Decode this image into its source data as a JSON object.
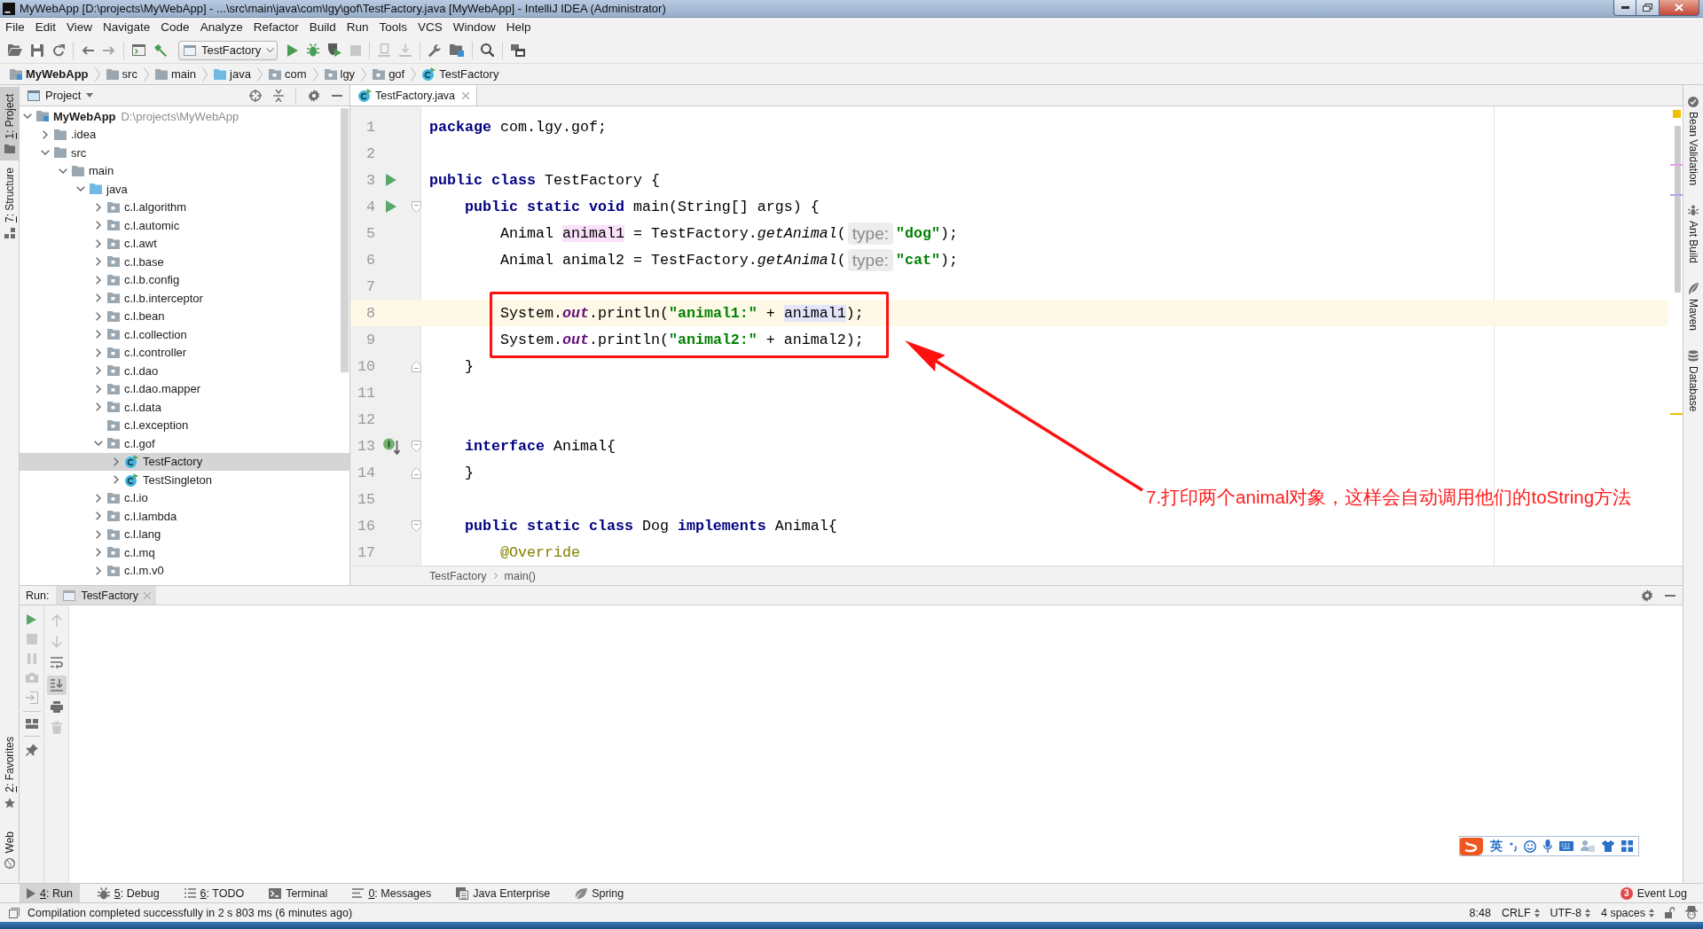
{
  "window": {
    "title": "MyWebApp [D:\\projects\\MyWebApp] - ...\\src\\main\\java\\com\\lgy\\gof\\TestFactory.java [MyWebApp] - IntelliJ IDEA (Administrator)"
  },
  "menu": [
    "File",
    "Edit",
    "View",
    "Navigate",
    "Code",
    "Analyze",
    "Refactor",
    "Build",
    "Run",
    "Tools",
    "VCS",
    "Window",
    "Help"
  ],
  "toolbar": {
    "run_config": "TestFactory"
  },
  "navigation_bar": [
    {
      "label": "MyWebApp",
      "kind": "module"
    },
    {
      "label": "src",
      "kind": "folder"
    },
    {
      "label": "main",
      "kind": "folder"
    },
    {
      "label": "java",
      "kind": "source-folder"
    },
    {
      "label": "com",
      "kind": "package"
    },
    {
      "label": "lgy",
      "kind": "package"
    },
    {
      "label": "gof",
      "kind": "package"
    },
    {
      "label": "TestFactory",
      "kind": "class"
    }
  ],
  "left_stripe": {
    "top": [
      {
        "key": "1",
        "label": ": Project",
        "selected": true
      },
      {
        "key": "7",
        "label": ": Structure",
        "selected": false
      }
    ],
    "bottom": [
      {
        "key": "2",
        "label": ": Favorites",
        "selected": false
      },
      {
        "label": "Web",
        "selected": false
      }
    ]
  },
  "project_panel": {
    "title": "Project",
    "tree": [
      {
        "label": "MyWebApp",
        "note": "D:\\projects\\MyWebApp",
        "kind": "module",
        "expanded": true,
        "selected": false,
        "children": [
          {
            "label": ".idea",
            "kind": "folder",
            "expanded": false,
            "selected": false
          },
          {
            "label": "src",
            "kind": "folder",
            "expanded": true,
            "selected": false,
            "children": [
              {
                "label": "main",
                "kind": "folder",
                "expanded": true,
                "selected": false,
                "children": [
                  {
                    "label": "java",
                    "kind": "source-folder",
                    "expanded": true,
                    "selected": false,
                    "children": [
                      {
                        "label": "c.l.algorithm",
                        "kind": "package",
                        "expanded": false,
                        "selected": false
                      },
                      {
                        "label": "c.l.automic",
                        "kind": "package",
                        "expanded": false,
                        "selected": false
                      },
                      {
                        "label": "c.l.awt",
                        "kind": "package",
                        "expanded": false,
                        "selected": false
                      },
                      {
                        "label": "c.l.base",
                        "kind": "package",
                        "expanded": false,
                        "selected": false
                      },
                      {
                        "label": "c.l.b.config",
                        "kind": "package",
                        "expanded": false,
                        "selected": false
                      },
                      {
                        "label": "c.l.b.interceptor",
                        "kind": "package",
                        "expanded": false,
                        "selected": false
                      },
                      {
                        "label": "c.l.bean",
                        "kind": "package",
                        "expanded": false,
                        "selected": false
                      },
                      {
                        "label": "c.l.collection",
                        "kind": "package",
                        "expanded": false,
                        "selected": false
                      },
                      {
                        "label": "c.l.controller",
                        "kind": "package",
                        "expanded": false,
                        "selected": false
                      },
                      {
                        "label": "c.l.dao",
                        "kind": "package",
                        "expanded": false,
                        "selected": false
                      },
                      {
                        "label": "c.l.dao.mapper",
                        "kind": "package",
                        "expanded": false,
                        "selected": false
                      },
                      {
                        "label": "c.l.data",
                        "kind": "package",
                        "expanded": false,
                        "selected": false
                      },
                      {
                        "label": "c.l.exception",
                        "kind": "package",
                        "selected": false
                      },
                      {
                        "label": "c.l.gof",
                        "kind": "package",
                        "expanded": true,
                        "selected": false,
                        "children": [
                          {
                            "label": "TestFactory",
                            "kind": "class",
                            "expanded": false,
                            "selected": true
                          },
                          {
                            "label": "TestSingleton",
                            "kind": "class",
                            "expanded": false,
                            "selected": false
                          }
                        ]
                      },
                      {
                        "label": "c.l.io",
                        "kind": "package",
                        "expanded": false,
                        "selected": false
                      },
                      {
                        "label": "c.l.lambda",
                        "kind": "package",
                        "expanded": false,
                        "selected": false
                      },
                      {
                        "label": "c.l.lang",
                        "kind": "package",
                        "expanded": false,
                        "selected": false
                      },
                      {
                        "label": "c.l.mq",
                        "kind": "package",
                        "expanded": false,
                        "selected": false
                      },
                      {
                        "label": "c.l.m.v0",
                        "kind": "package",
                        "expanded": false,
                        "selected": false
                      }
                    ]
                  }
                ]
              }
            ]
          }
        ]
      }
    ]
  },
  "editor": {
    "tabs": [
      {
        "label": "TestFactory.java",
        "selected": true
      }
    ],
    "lines": [
      {
        "number": "1",
        "current": false,
        "run_marker": false,
        "implements_marker": false,
        "fold_start": false,
        "fold_end": false,
        "tokens": [
          {
            "kind": "keyword",
            "text": "package"
          },
          {
            "kind": "plain",
            "text": " com.lgy.gof;"
          }
        ]
      },
      {
        "number": "2",
        "current": false,
        "run_marker": false,
        "implements_marker": false,
        "fold_start": false,
        "fold_end": false
      },
      {
        "number": "3",
        "current": false,
        "run_marker": true,
        "implements_marker": false,
        "fold_start": false,
        "fold_end": false,
        "tokens": [
          {
            "kind": "keyword",
            "text": "public class"
          },
          {
            "kind": "plain",
            "text": " TestFactory {"
          }
        ]
      },
      {
        "number": "4",
        "current": false,
        "run_marker": true,
        "implements_marker": false,
        "fold_start": true,
        "fold_end": false,
        "tokens": [
          {
            "kind": "keyword",
            "text": "    public static void"
          },
          {
            "kind": "plain",
            "text": " main(String[] args) {"
          }
        ]
      },
      {
        "number": "5",
        "current": false,
        "run_marker": false,
        "implements_marker": false,
        "fold_start": false,
        "fold_end": false,
        "tokens": [
          {
            "kind": "plain",
            "text": "        Animal "
          },
          {
            "kind": "declaration",
            "text": "animal1"
          },
          {
            "kind": "plain",
            "text": " = TestFactory."
          },
          {
            "kind": "method",
            "text": "getAnimal"
          },
          {
            "kind": "plain",
            "text": "("
          },
          {
            "kind": "hint",
            "text": "type:"
          },
          {
            "kind": "string",
            "text": "\"dog\""
          },
          {
            "kind": "plain",
            "text": ");"
          }
        ]
      },
      {
        "number": "6",
        "current": false,
        "run_marker": false,
        "implements_marker": false,
        "fold_start": false,
        "fold_end": false,
        "tokens": [
          {
            "kind": "plain",
            "text": "        Animal animal2 = TestFactory."
          },
          {
            "kind": "method",
            "text": "getAnimal"
          },
          {
            "kind": "plain",
            "text": "("
          },
          {
            "kind": "hint",
            "text": "type:"
          },
          {
            "kind": "string",
            "text": "\"cat\""
          },
          {
            "kind": "plain",
            "text": ");"
          }
        ]
      },
      {
        "number": "7",
        "current": false,
        "run_marker": false,
        "implements_marker": false,
        "fold_start": false,
        "fold_end": false
      },
      {
        "number": "8",
        "current": true,
        "run_marker": false,
        "implements_marker": false,
        "fold_start": false,
        "fold_end": false,
        "tokens": [
          {
            "kind": "plain",
            "text": "        System."
          },
          {
            "kind": "field",
            "text": "out"
          },
          {
            "kind": "plain",
            "text": ".println("
          },
          {
            "kind": "string",
            "text": "\"animal1:\""
          },
          {
            "kind": "plain",
            "text": " + "
          },
          {
            "kind": "usage",
            "text": "animal1"
          },
          {
            "kind": "plain",
            "text": ");"
          }
        ]
      },
      {
        "number": "9",
        "current": false,
        "run_marker": false,
        "implements_marker": false,
        "fold_start": false,
        "fold_end": false,
        "tokens": [
          {
            "kind": "plain",
            "text": "        System."
          },
          {
            "kind": "field",
            "text": "out"
          },
          {
            "kind": "plain",
            "text": ".println("
          },
          {
            "kind": "string",
            "text": "\"animal2:\""
          },
          {
            "kind": "plain",
            "text": " + animal2);"
          }
        ]
      },
      {
        "number": "10",
        "current": false,
        "run_marker": false,
        "implements_marker": false,
        "fold_start": false,
        "fold_end": true,
        "tokens": [
          {
            "kind": "plain",
            "text": "    }"
          }
        ]
      },
      {
        "number": "11",
        "current": false,
        "run_marker": false,
        "implements_marker": false,
        "fold_start": false,
        "fold_end": false
      },
      {
        "number": "12",
        "current": false,
        "run_marker": false,
        "implements_marker": false,
        "fold_start": false,
        "fold_end": false
      },
      {
        "number": "13",
        "current": false,
        "run_marker": false,
        "implements_marker": true,
        "fold_start": true,
        "fold_end": false,
        "tokens": [
          {
            "kind": "keyword",
            "text": "    interface"
          },
          {
            "kind": "plain",
            "text": " Animal{"
          }
        ]
      },
      {
        "number": "14",
        "current": false,
        "run_marker": false,
        "implements_marker": false,
        "fold_start": false,
        "fold_end": true,
        "tokens": [
          {
            "kind": "plain",
            "text": "    }"
          }
        ]
      },
      {
        "number": "15",
        "current": false,
        "run_marker": false,
        "implements_marker": false,
        "fold_start": false,
        "fold_end": false
      },
      {
        "number": "16",
        "current": false,
        "run_marker": false,
        "implements_marker": false,
        "fold_start": true,
        "fold_end": false,
        "tokens": [
          {
            "kind": "keyword",
            "text": "    public static class"
          },
          {
            "kind": "plain",
            "text": " Dog "
          },
          {
            "kind": "keyword",
            "text": "implements"
          },
          {
            "kind": "plain",
            "text": " Animal{"
          }
        ]
      },
      {
        "number": "17",
        "current": false,
        "run_marker": false,
        "implements_marker": false,
        "fold_start": false,
        "fold_end": false,
        "tokens": [
          {
            "kind": "annotation",
            "text": "        @Override"
          }
        ]
      }
    ],
    "breadcrumb": [
      "TestFactory",
      "main()"
    ]
  },
  "right_stripe": [
    {
      "label": "Bean Validation",
      "selected": false
    },
    {
      "label": "Ant Build",
      "selected": false
    },
    {
      "label": "Maven",
      "selected": false
    },
    {
      "label": "Database",
      "selected": false
    }
  ],
  "annotation": {
    "text": "7.打印两个animal对象，这样会自动调用他们的toString方法"
  },
  "run_panel": {
    "title": "Run:",
    "tabs": [
      {
        "label": "TestFactory",
        "selected": true
      }
    ],
    "scroll_to_end_active": true
  },
  "ime_toolbar": {
    "mode": "英"
  },
  "tool_window_bar": {
    "buttons": [
      {
        "key": "4",
        "label": ": Run",
        "selected": true
      },
      {
        "key": "5",
        "label": ": Debug",
        "selected": false
      },
      {
        "key": "6",
        "label": ": TODO",
        "selected": false
      },
      {
        "label": "Terminal",
        "selected": false
      },
      {
        "key": "0",
        "label": ": Messages",
        "selected": false
      },
      {
        "label": "Java Enterprise",
        "selected": false
      },
      {
        "label": "Spring",
        "selected": false
      }
    ],
    "event_log": {
      "label": "Event Log",
      "badge": "3"
    }
  },
  "status_bar": {
    "message": "Compilation completed successfully in 2 s 803 ms (6 minutes ago)",
    "position": "8:48",
    "line_separator": "CRLF",
    "encoding": "UTF-8",
    "indent": "4 spaces"
  }
}
